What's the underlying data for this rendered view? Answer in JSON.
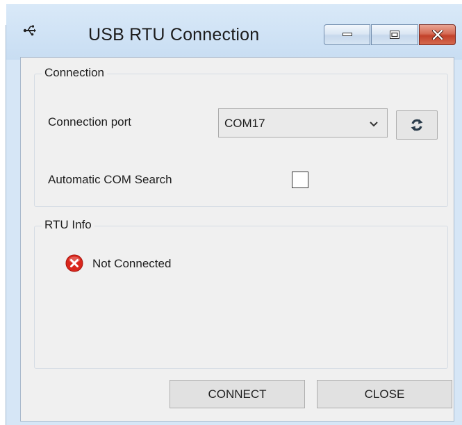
{
  "window": {
    "title": "USB RTU Connection",
    "app_icon": "usb-icon",
    "caption_buttons": [
      "minimize-icon",
      "maximize-icon",
      "close-icon"
    ]
  },
  "connection_group": {
    "title": "Connection",
    "port_label": "Connection port",
    "port_value": "COM17",
    "refresh_icon": "refresh-icon",
    "auto_search_label": "Automatic COM Search",
    "auto_search_checked": false
  },
  "rtu_info_group": {
    "title": "RTU Info",
    "status_icon": "error-icon",
    "status_text": "Not Connected",
    "status_color": "#d9261c"
  },
  "buttons": {
    "connect_label": "CONNECT",
    "close_label": "CLOSE"
  }
}
